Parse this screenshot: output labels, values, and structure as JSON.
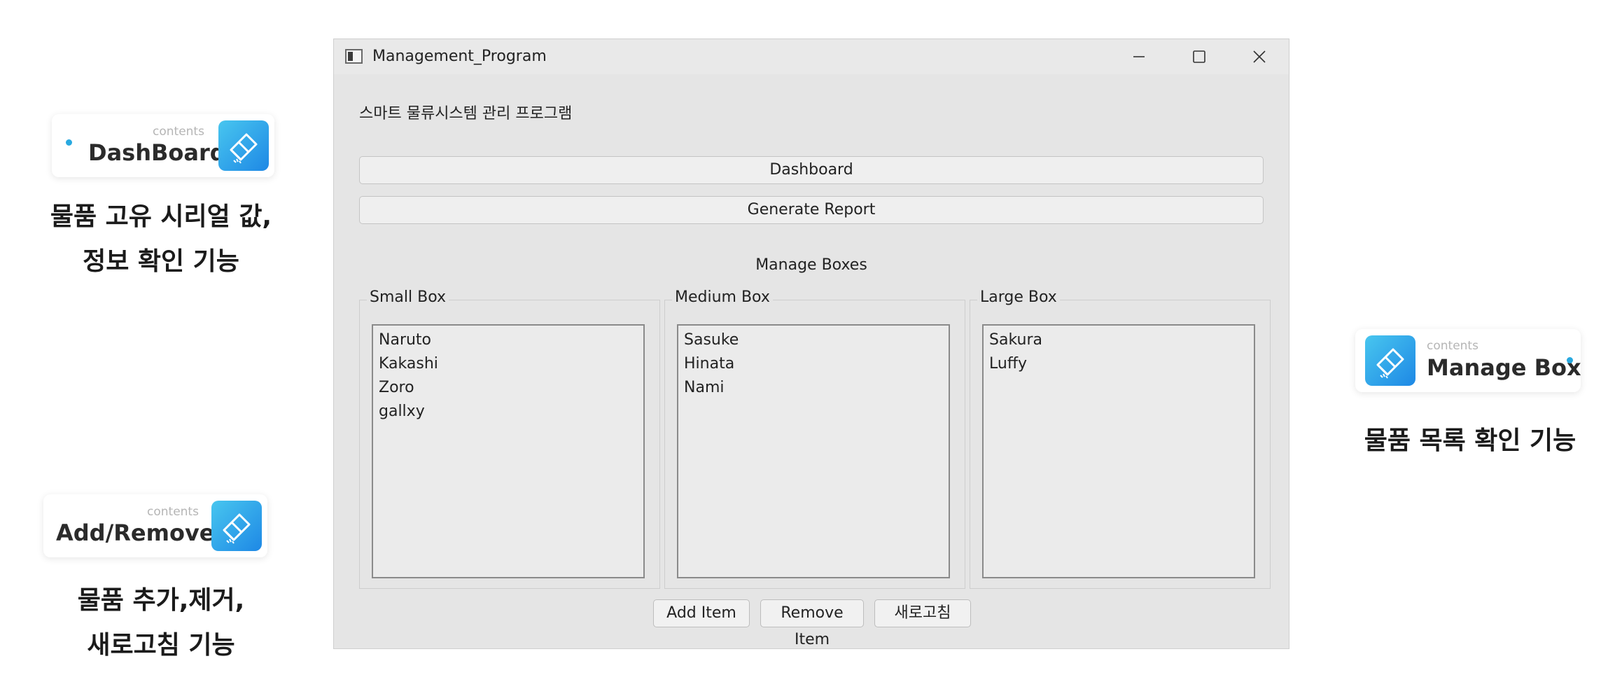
{
  "window": {
    "title": "Management_Program",
    "heading": "스마트 물류시스템 관리 프로그램",
    "buttons": {
      "dashboard": "Dashboard",
      "generate_report": "Generate Report"
    },
    "manage_label": "Manage Boxes",
    "groups": {
      "small": {
        "title": "Small Box",
        "items": [
          "Naruto",
          "Kakashi",
          "Zoro",
          "gallxy"
        ]
      },
      "medium": {
        "title": "Medium Box",
        "items": [
          "Sasuke",
          "Hinata",
          "Nami"
        ]
      },
      "large": {
        "title": "Large Box",
        "items": [
          "Sakura",
          "Luffy"
        ]
      }
    },
    "actions": {
      "add": "Add Item",
      "remove": "Remove Item",
      "refresh": "새로고침"
    }
  },
  "callouts": {
    "dashboard": {
      "small": "contents",
      "label": "DashBoard",
      "caption_line1": "물품 고유 시리얼 값,",
      "caption_line2": "정보 확인 기능"
    },
    "add_remove": {
      "small": "contents",
      "label": "Add/Remove",
      "caption_line1": "물품 추가,제거,",
      "caption_line2": "새로고침 기능"
    },
    "manage_box": {
      "small": "contents",
      "label": "Manage Box",
      "caption_line1": "물품 목록 확인 기능"
    }
  },
  "colors": {
    "accent": "#29a9e0",
    "icon_gradient_start": "#48c6ef",
    "icon_gradient_end": "#1e88e5",
    "window_bg": "#e5e5e5"
  },
  "icons": {
    "badge_icon": "eraser-icon",
    "app_icon": "window-app-icon",
    "minimize": "minimize-icon",
    "maximize": "maximize-icon",
    "close": "close-icon"
  }
}
